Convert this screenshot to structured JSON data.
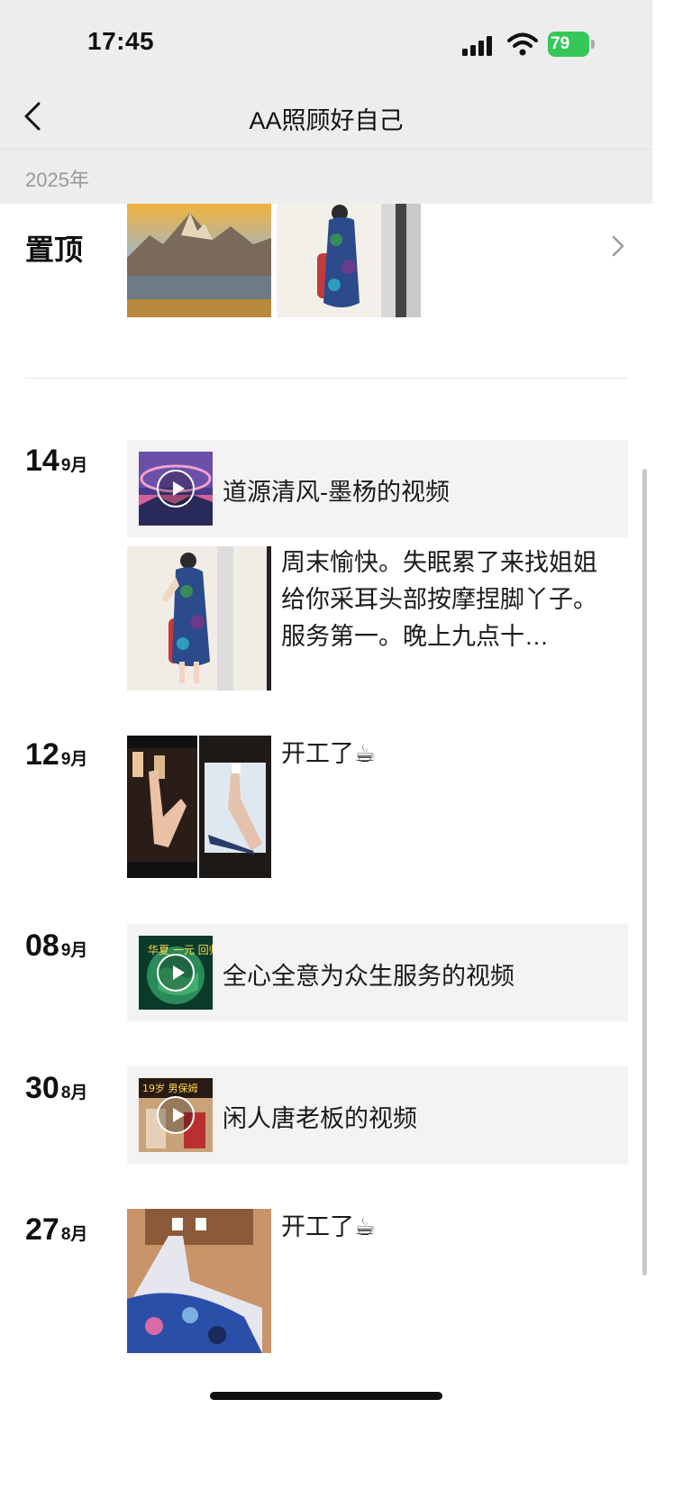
{
  "status_bar": {
    "time": "17:45",
    "battery": "79"
  },
  "nav": {
    "title": "AA照顾好自己"
  },
  "year_label": "2025年",
  "pinned": {
    "label": "置顶"
  },
  "entries": [
    {
      "day": "14",
      "month": "9月",
      "items": [
        {
          "kind": "shared-video",
          "text": "道源清风-墨杨的视频"
        },
        {
          "kind": "post",
          "text": "周末愉快。失眠累了来找姐姐给你采耳头部按摩捏脚丫子。服务第一。晚上九点十…"
        }
      ]
    },
    {
      "day": "12",
      "month": "9月",
      "items": [
        {
          "kind": "post",
          "text": "开工了☕"
        }
      ]
    },
    {
      "day": "08",
      "month": "9月",
      "items": [
        {
          "kind": "shared-video",
          "text": "全心全意为众生服务的视频"
        }
      ]
    },
    {
      "day": "30",
      "month": "8月",
      "items": [
        {
          "kind": "shared-video",
          "text": "闲人唐老板的视频"
        }
      ]
    },
    {
      "day": "27",
      "month": "8月",
      "items": [
        {
          "kind": "post",
          "text": "开工了☕"
        }
      ]
    }
  ],
  "thumb_texts": {
    "video3_caption": "19岁 男保姆",
    "video2_caption": "华夏 一元 回归"
  },
  "colors": {
    "battery": "#35c759",
    "nav_bg": "#ededed",
    "card_bg": "#f3f3f3"
  }
}
